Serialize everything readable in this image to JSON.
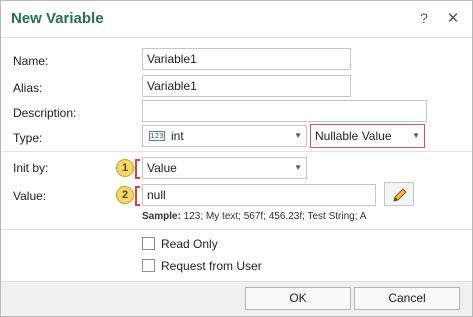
{
  "dialog": {
    "title": "New Variable",
    "help_glyph": "?",
    "close_glyph": "✕"
  },
  "fields": {
    "name": {
      "label": "Name:",
      "value": "Variable1"
    },
    "alias": {
      "label": "Alias:",
      "value": "Variable1"
    },
    "description": {
      "label": "Description:",
      "value": ""
    },
    "type": {
      "label": "Type:",
      "icon_text": "123",
      "value": "int",
      "nullable_value": "Nullable Value"
    },
    "init_by": {
      "label": "Init by:",
      "value": "Value"
    },
    "value": {
      "label": "Value:",
      "value": "null"
    }
  },
  "markers": {
    "one": "1",
    "two": "2"
  },
  "sample": {
    "prefix": "Sample:",
    "text": " 123; My text; 567f; 456.23f; Test String; A"
  },
  "options": {
    "read_only": {
      "label": "Read Only",
      "checked": false
    },
    "request_from_user": {
      "label": "Request from User",
      "checked": false
    }
  },
  "buttons": {
    "ok": "OK",
    "cancel": "Cancel"
  },
  "colors": {
    "title": "#2d6b5a",
    "highlight_red": "#d94040",
    "badge": "#f5d76e"
  },
  "icons": {
    "type": "number-type-icon",
    "edit": "pencil-icon"
  }
}
